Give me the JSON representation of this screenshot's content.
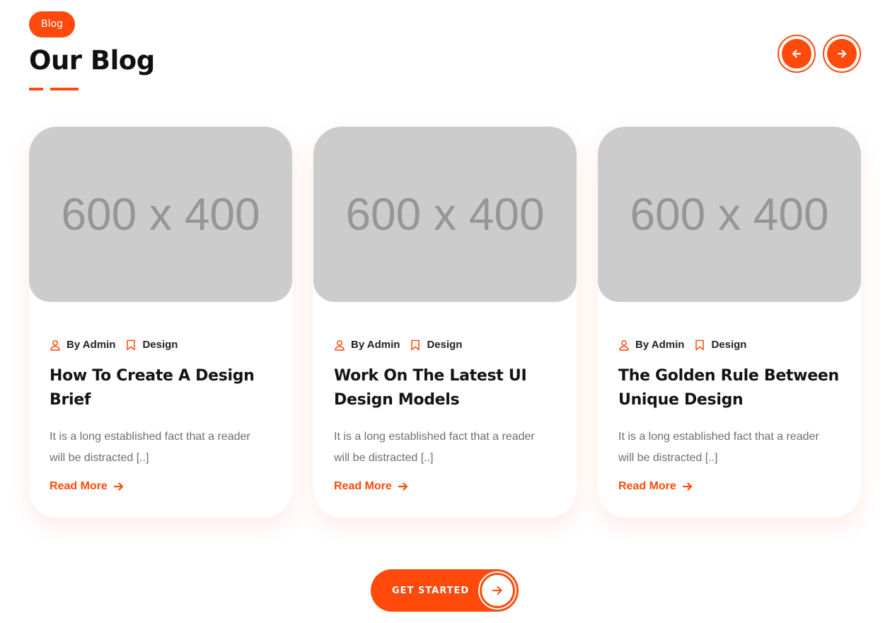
{
  "header": {
    "badge": "Blog",
    "title": "Our Blog"
  },
  "nav": {
    "prev_icon": "arrow-left-icon",
    "next_icon": "arrow-right-icon"
  },
  "colors": {
    "accent": "#ff4a0b",
    "placeholder_bg": "#cccccc",
    "placeholder_text": "#969696"
  },
  "posts": [
    {
      "image_text": "600 x 400",
      "author": "By Admin",
      "category": "Design",
      "title": "How To Create A Design Brief",
      "excerpt": "It is a long established fact that a reader will be distracted [..]",
      "read_more": "Read More"
    },
    {
      "image_text": "600 x 400",
      "author": "By Admin",
      "category": "Design",
      "title": "Work On The Latest UI Design Models",
      "excerpt": "It is a long established fact that a reader will be distracted [..]",
      "read_more": "Read More"
    },
    {
      "image_text": "600 x 400",
      "author": "By Admin",
      "category": "Design",
      "title": "The Golden Rule Between Unique Design",
      "excerpt": "It is a long established fact that a reader will be distracted [..]",
      "read_more": "Read More"
    }
  ],
  "cta": {
    "label": "GET STARTED"
  }
}
